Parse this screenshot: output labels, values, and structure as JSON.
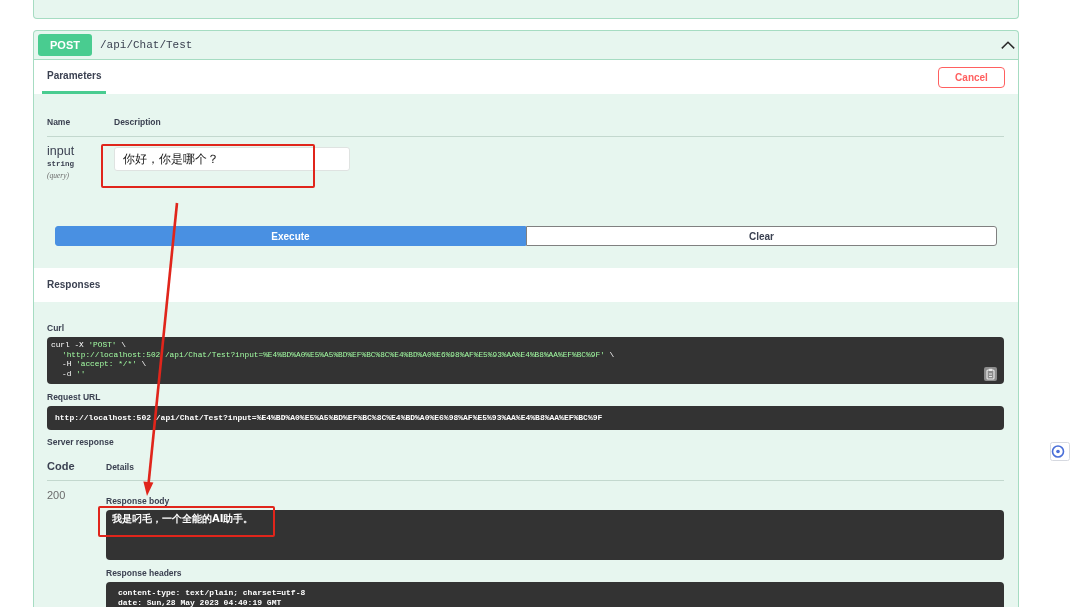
{
  "operation": {
    "method": "POST",
    "path": "/api/Chat/Test",
    "expanded": true,
    "tabs": [
      {
        "label": "Parameters",
        "selected": true
      }
    ],
    "cancel_button": "Cancel",
    "parameters": {
      "columns": [
        "Name",
        "Description"
      ],
      "rows": [
        {
          "name": "input",
          "type": "string",
          "location": "(query)",
          "value": "你好，你是哪个？"
        }
      ]
    },
    "buttons": [
      {
        "label": "Execute",
        "kind": "primary"
      },
      {
        "label": "Clear",
        "kind": "secondary"
      }
    ],
    "responses": {
      "title": "Responses",
      "curl": {
        "label": "Curl",
        "lines": [
          {
            "indented": false,
            "parts": [
              {
                "kind": "plain",
                "text": "curl -X "
              },
              {
                "kind": "string",
                "text": "'POST'"
              },
              {
                "kind": "plain",
                "text": " \\"
              }
            ]
          },
          {
            "indented": true,
            "parts": [
              {
                "kind": "string",
                "text": "'http://localhost:502"
              },
              {
                "kind": "covered"
              },
              {
                "kind": "string",
                "text": "/api/Chat/Test?input=%E4%BD%A0%E5%A5%BD%EF%BC%8C%E4%BD%A0%E6%98%AF%E5%93%AA%E4%B8%AA%EF%BC%9F'"
              },
              {
                "kind": "plain",
                "text": " \\"
              }
            ]
          },
          {
            "indented": true,
            "parts": [
              {
                "kind": "plain",
                "text": "-H "
              },
              {
                "kind": "string",
                "text": "'accept: */*'"
              },
              {
                "kind": "plain",
                "text": " \\"
              }
            ]
          },
          {
            "indented": true,
            "parts": [
              {
                "kind": "plain",
                "text": "-d "
              },
              {
                "kind": "string",
                "text": "''"
              }
            ]
          }
        ]
      },
      "request_url": {
        "label": "Request URL",
        "parts": [
          {
            "kind": "plain",
            "text": "http://localhost:502"
          },
          {
            "kind": "covered"
          },
          {
            "kind": "plain",
            "text": "/api/Chat/Test?input=%E4%BD%A0%E5%A5%BD%EF%BC%8C%E4%BD%A0%E6%98%AF%E5%93%AA%E4%B8%AA%EF%BC%9F"
          }
        ]
      },
      "server_response": {
        "label": "Server response",
        "columns": [
          "Code",
          "Details"
        ],
        "code": "200",
        "body_label": "Response body",
        "body": "我是叼毛，一个全能的AI助手。",
        "headers_label": "Response headers",
        "headers": [
          "content-type: text/plain; charset=utf-8",
          "date: Sun,28 May 2023 04:40:19 GMT"
        ]
      }
    }
  }
}
